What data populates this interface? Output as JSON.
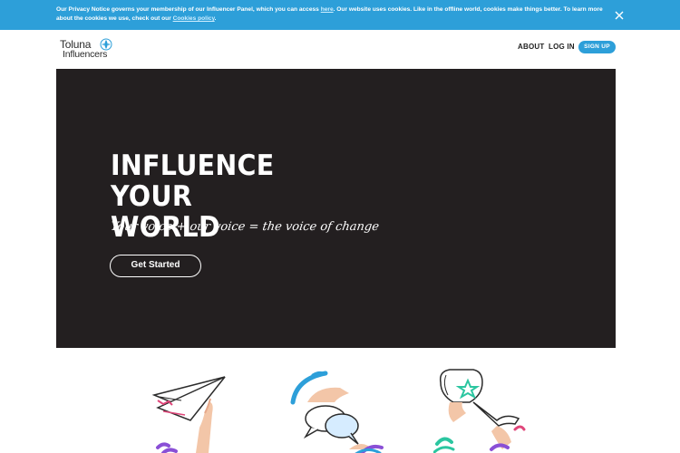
{
  "cookie_banner": {
    "text_part1": "Our Privacy Notice governs your membership of our Influencer Panel, which you can access ",
    "link_here": "here",
    "text_part2": ". Our website uses cookies. Like in the offline world, cookies make things better. To learn more about the cookies we use, check out our ",
    "link_policy": "Cookies policy",
    "text_part3": ".",
    "close_icon": "close-icon"
  },
  "header": {
    "logo_line1": "Toluna",
    "logo_line2": "Influencers",
    "nav": {
      "about": "ABOUT",
      "login": "LOG IN",
      "signup": "SIGN UP"
    }
  },
  "hero": {
    "title_line1": "INFLUENCE YOUR",
    "title_line2": "WORLD",
    "subtitle": "Your voice + our voice = the voice of change",
    "cta": "Get Started"
  },
  "illustrations": [
    {
      "icon": "paper-plane-icon"
    },
    {
      "icon": "speech-bubbles-icon"
    },
    {
      "icon": "trophy-icon"
    }
  ],
  "colors": {
    "accent": "#2d9fd9",
    "hero_bg": "#231f20",
    "purple": "#8a4fd6",
    "green": "#2bc6a0",
    "pink": "#e0467a"
  }
}
